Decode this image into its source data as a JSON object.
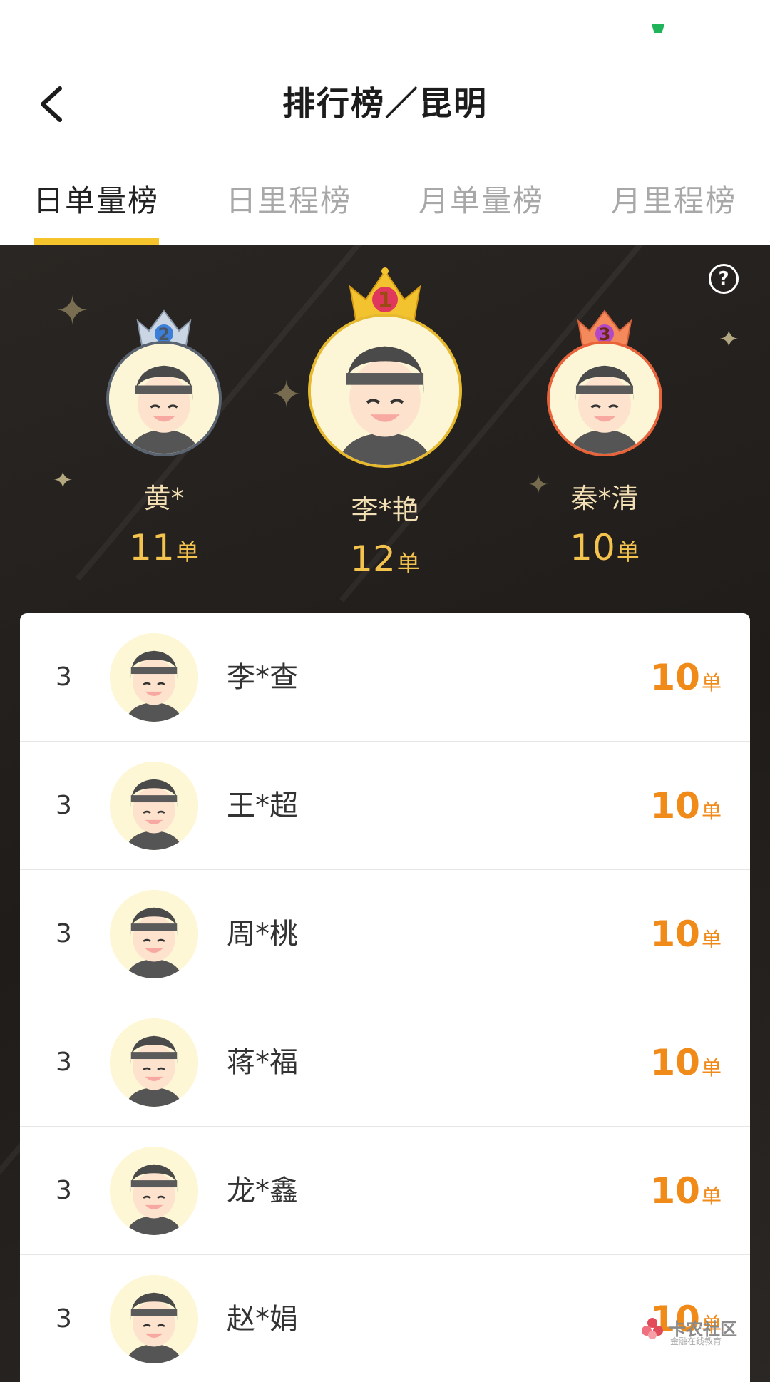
{
  "header": {
    "title": "排行榜／昆明"
  },
  "tabs": [
    {
      "label": "日单量榜",
      "active": true
    },
    {
      "label": "日里程榜",
      "active": false
    },
    {
      "label": "月单量榜",
      "active": false
    },
    {
      "label": "月里程榜",
      "active": false
    }
  ],
  "podium": {
    "help_symbol": "?",
    "first": {
      "rank": "1",
      "name": "李*艳",
      "count": "12",
      "unit": "单",
      "color": "#e7b92e"
    },
    "second": {
      "rank": "2",
      "name": "黄*",
      "count": "11",
      "unit": "单",
      "color": "#5a6370"
    },
    "third": {
      "rank": "3",
      "name": "秦*清",
      "count": "10",
      "unit": "单",
      "color": "#e8623a"
    }
  },
  "list": [
    {
      "rank": "3",
      "name": "李*查",
      "count": "10",
      "unit": "单"
    },
    {
      "rank": "3",
      "name": "王*超",
      "count": "10",
      "unit": "单"
    },
    {
      "rank": "3",
      "name": "周*桃",
      "count": "10",
      "unit": "单"
    },
    {
      "rank": "3",
      "name": "蒋*福",
      "count": "10",
      "unit": "单"
    },
    {
      "rank": "3",
      "name": "龙*鑫",
      "count": "10",
      "unit": "单"
    },
    {
      "rank": "3",
      "name": "赵*娟",
      "count": "10",
      "unit": "单"
    }
  ],
  "watermark": {
    "title": "卡农社区",
    "subtitle": "金融在线教育"
  },
  "colors": {
    "accent": "#f5c42c",
    "score": "#f08a19",
    "podium_bg": "#221f1c"
  }
}
